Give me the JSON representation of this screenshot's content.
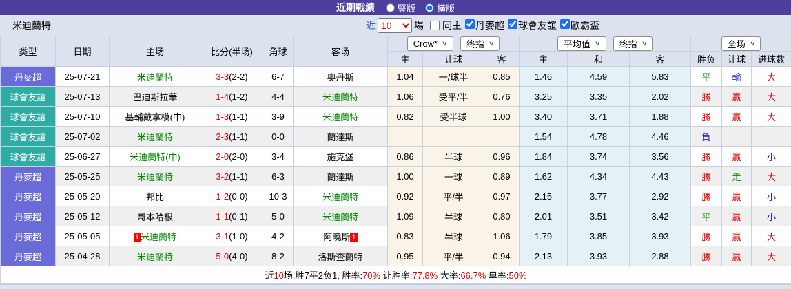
{
  "title_bar": {
    "title": "近期戰績",
    "radio_vertical": "豎版",
    "radio_horizontal": "橫版"
  },
  "filter_bar": {
    "team": "米迪蘭特",
    "near_label": "近",
    "match_count": "10",
    "games_label": "場",
    "same_home_label": "同主",
    "leagues": [
      "丹麥超",
      "球會友誼",
      "歐霸盃"
    ]
  },
  "colors": {
    "topbar_purple": "#4d3f9e",
    "league_badge_purple": "#6a6ad8",
    "friendly_badge_teal": "#2fada4",
    "win_red": "#e60000",
    "lose_blue": "#2222cc",
    "draw_green": "#008800",
    "crow_cell_bg": "#faf3e8",
    "avg_cell_bg": "#e4f1f7"
  },
  "table": {
    "headers": {
      "type": "类型",
      "date": "日期",
      "home": "主场",
      "score": "比分(半场)",
      "corner": "角球",
      "away": "客场",
      "crow_company": "Crow*",
      "crow_line": "终指",
      "avg_company": "平均值",
      "avg_line": "终指",
      "full_scope": "全场",
      "crow_cols": [
        "主",
        "让球",
        "客"
      ],
      "avg_cols": [
        "主",
        "和",
        "客"
      ],
      "result_cols": [
        "胜负",
        "让球",
        "进球数"
      ]
    },
    "rows": [
      {
        "type": "丹麥超",
        "type_color": "purple",
        "date": "25-07-21",
        "home": "米迪蘭特",
        "home_green": true,
        "home_badge": "",
        "score_ft": "3-3",
        "score_ht": "(2-2)",
        "corner": "6-7",
        "away": "奧丹斯",
        "away_green": false,
        "away_badge": "",
        "crow": [
          "1.04",
          "一/球半",
          "0.85"
        ],
        "avg": [
          "1.46",
          "4.59",
          "5.83"
        ],
        "result": [
          {
            "text": "平",
            "color": "green"
          },
          {
            "text": "輸",
            "color": "blue"
          },
          {
            "text": "大",
            "color": "red"
          }
        ]
      },
      {
        "type": "球會友誼",
        "type_color": "teal",
        "date": "25-07-13",
        "home": "巴迪斯拉華",
        "home_green": false,
        "home_badge": "",
        "score_ft": "1-4",
        "score_ht": "(1-2)",
        "corner": "4-4",
        "away": "米迪蘭特",
        "away_green": true,
        "away_badge": "",
        "crow": [
          "1.06",
          "受平/半",
          "0.76"
        ],
        "avg": [
          "3.25",
          "3.35",
          "2.02"
        ],
        "result": [
          {
            "text": "勝",
            "color": "red"
          },
          {
            "text": "贏",
            "color": "red"
          },
          {
            "text": "大",
            "color": "red"
          }
        ]
      },
      {
        "type": "球會友誼",
        "type_color": "teal",
        "date": "25-07-10",
        "home": "基輔戴拿模(中)",
        "home_green": false,
        "home_badge": "",
        "score_ft": "1-3",
        "score_ht": "(1-1)",
        "corner": "3-9",
        "away": "米迪蘭特",
        "away_green": true,
        "away_badge": "",
        "crow": [
          "0.82",
          "受半球",
          "1.00"
        ],
        "avg": [
          "3.40",
          "3.71",
          "1.88"
        ],
        "result": [
          {
            "text": "勝",
            "color": "red"
          },
          {
            "text": "贏",
            "color": "red"
          },
          {
            "text": "大",
            "color": "red"
          }
        ]
      },
      {
        "type": "球會友誼",
        "type_color": "teal",
        "date": "25-07-02",
        "home": "米迪蘭特",
        "home_green": true,
        "home_badge": "",
        "score_ft": "2-3",
        "score_ht": "(1-1)",
        "corner": "0-0",
        "away": "蘭達斯",
        "away_green": false,
        "away_badge": "",
        "crow": [
          "",
          "",
          ""
        ],
        "avg": [
          "1.54",
          "4.78",
          "4.46"
        ],
        "result": [
          {
            "text": "負",
            "color": "blue"
          },
          {
            "text": "",
            "color": ""
          },
          {
            "text": "",
            "color": ""
          }
        ]
      },
      {
        "type": "球會友誼",
        "type_color": "teal",
        "date": "25-06-27",
        "home": "米迪蘭特(中)",
        "home_green": true,
        "home_badge": "",
        "score_ft": "2-0",
        "score_ht": "(2-0)",
        "corner": "3-4",
        "away": "施克堡",
        "away_green": false,
        "away_badge": "",
        "crow": [
          "0.86",
          "半球",
          "0.96"
        ],
        "avg": [
          "1.84",
          "3.74",
          "3.56"
        ],
        "result": [
          {
            "text": "勝",
            "color": "red"
          },
          {
            "text": "贏",
            "color": "red"
          },
          {
            "text": "小",
            "color": "blue"
          }
        ]
      },
      {
        "type": "丹麥超",
        "type_color": "purple",
        "date": "25-05-25",
        "home": "米迪蘭特",
        "home_green": true,
        "home_badge": "",
        "score_ft": "3-2",
        "score_ht": "(1-1)",
        "corner": "6-3",
        "away": "蘭達斯",
        "away_green": false,
        "away_badge": "",
        "crow": [
          "1.00",
          "一球",
          "0.89"
        ],
        "avg": [
          "1.62",
          "4.34",
          "4.43"
        ],
        "result": [
          {
            "text": "勝",
            "color": "red"
          },
          {
            "text": "走",
            "color": "green"
          },
          {
            "text": "大",
            "color": "red"
          }
        ]
      },
      {
        "type": "丹麥超",
        "type_color": "purple",
        "date": "25-05-20",
        "home": "邦比",
        "home_green": false,
        "home_badge": "",
        "score_ft": "1-2",
        "score_ht": "(0-0)",
        "corner": "10-3",
        "away": "米迪蘭特",
        "away_green": true,
        "away_badge": "",
        "crow": [
          "0.92",
          "平/半",
          "0.97"
        ],
        "avg": [
          "2.15",
          "3.77",
          "2.92"
        ],
        "result": [
          {
            "text": "勝",
            "color": "red"
          },
          {
            "text": "贏",
            "color": "red"
          },
          {
            "text": "小",
            "color": "blue"
          }
        ]
      },
      {
        "type": "丹麥超",
        "type_color": "purple",
        "date": "25-05-12",
        "home": "哥本哈根",
        "home_green": false,
        "home_badge": "",
        "score_ft": "1-1",
        "score_ht": "(0-1)",
        "corner": "5-0",
        "away": "米迪蘭特",
        "away_green": true,
        "away_badge": "",
        "crow": [
          "1.09",
          "半球",
          "0.80"
        ],
        "avg": [
          "2.01",
          "3.51",
          "3.42"
        ],
        "result": [
          {
            "text": "平",
            "color": "green"
          },
          {
            "text": "贏",
            "color": "red"
          },
          {
            "text": "小",
            "color": "blue"
          }
        ]
      },
      {
        "type": "丹麥超",
        "type_color": "purple",
        "date": "25-05-05",
        "home": "米迪蘭特",
        "home_green": true,
        "home_badge": "1",
        "score_ft": "3-1",
        "score_ht": "(1-0)",
        "corner": "4-2",
        "away": "阿曉斯",
        "away_green": false,
        "away_badge": "1",
        "crow": [
          "0.83",
          "半球",
          "1.06"
        ],
        "avg": [
          "1.79",
          "3.85",
          "3.93"
        ],
        "result": [
          {
            "text": "勝",
            "color": "red"
          },
          {
            "text": "贏",
            "color": "red"
          },
          {
            "text": "大",
            "color": "red"
          }
        ]
      },
      {
        "type": "丹麥超",
        "type_color": "purple",
        "date": "25-04-28",
        "home": "米迪蘭特",
        "home_green": true,
        "home_badge": "",
        "score_ft": "5-0",
        "score_ht": "(4-0)",
        "corner": "8-2",
        "away": "洛斯查蘭特",
        "away_green": false,
        "away_badge": "",
        "crow": [
          "0.95",
          "平/半",
          "0.94"
        ],
        "avg": [
          "2.13",
          "3.93",
          "2.88"
        ],
        "result": [
          {
            "text": "勝",
            "color": "red"
          },
          {
            "text": "贏",
            "color": "red"
          },
          {
            "text": "大",
            "color": "red"
          }
        ]
      }
    ]
  },
  "footer": {
    "segments": [
      {
        "text": "近",
        "red": false
      },
      {
        "text": "10",
        "red": true
      },
      {
        "text": "场,胜7平2负1, 胜率:",
        "red": false
      },
      {
        "text": "70%",
        "red": true
      },
      {
        "text": " 让胜率:",
        "red": false
      },
      {
        "text": "77.8%",
        "red": true
      },
      {
        "text": " 大率:",
        "red": false
      },
      {
        "text": "66.7%",
        "red": true
      },
      {
        "text": " 单率:",
        "red": false
      },
      {
        "text": "50%",
        "red": true
      }
    ]
  }
}
